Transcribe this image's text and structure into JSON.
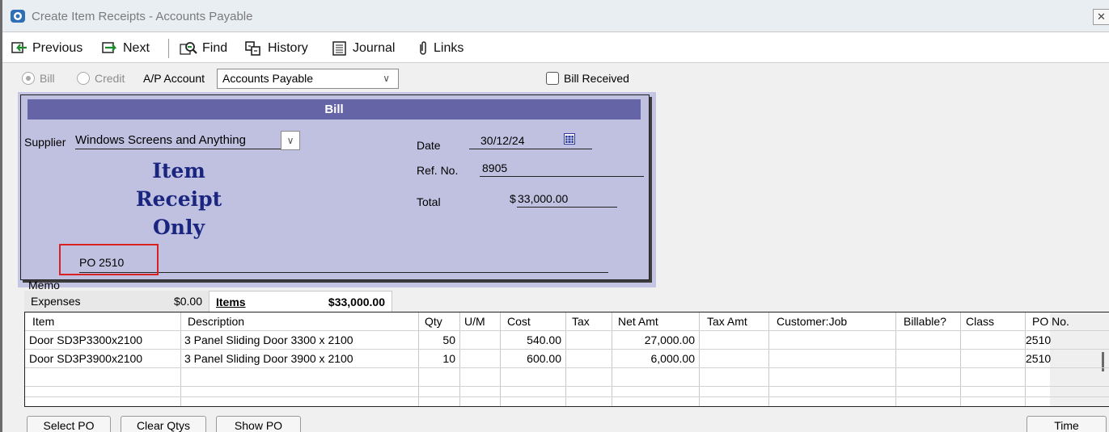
{
  "window": {
    "title": "Create Item Receipts - Accounts Payable",
    "close_glyph": "✕"
  },
  "toolbar": {
    "previous": "Previous",
    "next": "Next",
    "find": "Find",
    "history": "History",
    "journal": "Journal",
    "links": "Links"
  },
  "form": {
    "bill_option": "Bill",
    "credit_option": "Credit",
    "ap_account_label": "A/P Account",
    "ap_account_value": "Accounts Payable",
    "bill_received_label": "Bill Received",
    "bill_received_checked": false,
    "header": "Bill",
    "supplier_label": "Supplier",
    "supplier_value": "Windows Screens and Anything",
    "stamp_line1": "Item",
    "stamp_line2": "Receipt",
    "stamp_line3": "Only",
    "date_label": "Date",
    "date_value": "30/12/24",
    "ref_label": "Ref. No.",
    "ref_value": "8905",
    "total_label": "Total",
    "total_currency": "$",
    "total_value": "33,000.00",
    "memo_label": "Memo",
    "memo_value": "PO 2510"
  },
  "tabs": {
    "expenses_label": "Expenses",
    "expenses_amount": "$0.00",
    "items_label": "Items",
    "items_amount": "$33,000.00"
  },
  "grid": {
    "headers": [
      "Item",
      "Description",
      "Qty",
      "U/M",
      "Cost",
      "Tax",
      "Net Amt",
      "Tax Amt",
      "Customer:Job",
      "Billable?",
      "Class",
      "PO No."
    ],
    "rows": [
      [
        "Door SD3P3300x2100",
        "3 Panel Sliding Door 3300 x 2100",
        "50",
        "",
        "540.00",
        "",
        "27,000.00",
        "",
        "",
        "",
        "",
        "2510"
      ],
      [
        "Door SD3P3900x2100",
        "3 Panel Sliding Door 3900 x 2100",
        "10",
        "",
        "600.00",
        "",
        "6,000.00",
        "",
        "",
        "",
        "",
        "2510"
      ]
    ]
  },
  "buttons": {
    "select_po": "Select PO",
    "clear_qtys": "Clear Qtys",
    "show_po": "Show PO",
    "time": "Time"
  },
  "colors": {
    "panel": "#c0c0e0",
    "panel_header": "#6464a6",
    "stamp": "#1a2580",
    "highlight": "#d92121"
  }
}
